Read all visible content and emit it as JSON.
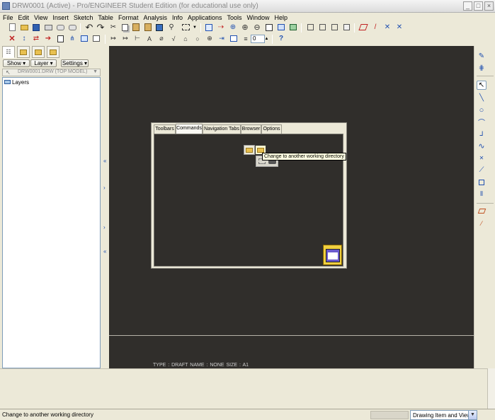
{
  "window": {
    "title": "DRW0001 (Active) - Pro/ENGINEER Student Edition (for educational use only)",
    "minimize_glyph": "_",
    "maximize_glyph": "□",
    "close_glyph": "×"
  },
  "menu": [
    "File",
    "Edit",
    "View",
    "Insert",
    "Sketch",
    "Table",
    "Format",
    "Analysis",
    "Info",
    "Applications",
    "Tools",
    "Window",
    "Help"
  ],
  "toolbar": {
    "zoom_value": "0"
  },
  "navigator": {
    "buttons": {
      "show": "Show ▾",
      "layer": "Layer ▾",
      "settings": "Settings ▾"
    },
    "model_select": "DRW0001.DRW (TOP MODEL)",
    "tree_items": [
      "Layers"
    ]
  },
  "dialog": {
    "tabs": [
      "Toolbars",
      "Commands",
      "Navigation Tabs",
      "Browser",
      "Options"
    ],
    "active_tab": "Commands",
    "tooltip": "Change to another working directory"
  },
  "canvas": {
    "info_line": "TYPE : DRAFT    NAME : NONE    SIZE : A1",
    "background": "#302e2b"
  },
  "statusbar": {
    "message": "Change to another working directory",
    "filter_value": "Drawing Item and View"
  },
  "colors": {
    "chrome": "#ece9d8",
    "accent_blue": "#2050b0",
    "accent_red": "#c02020"
  }
}
